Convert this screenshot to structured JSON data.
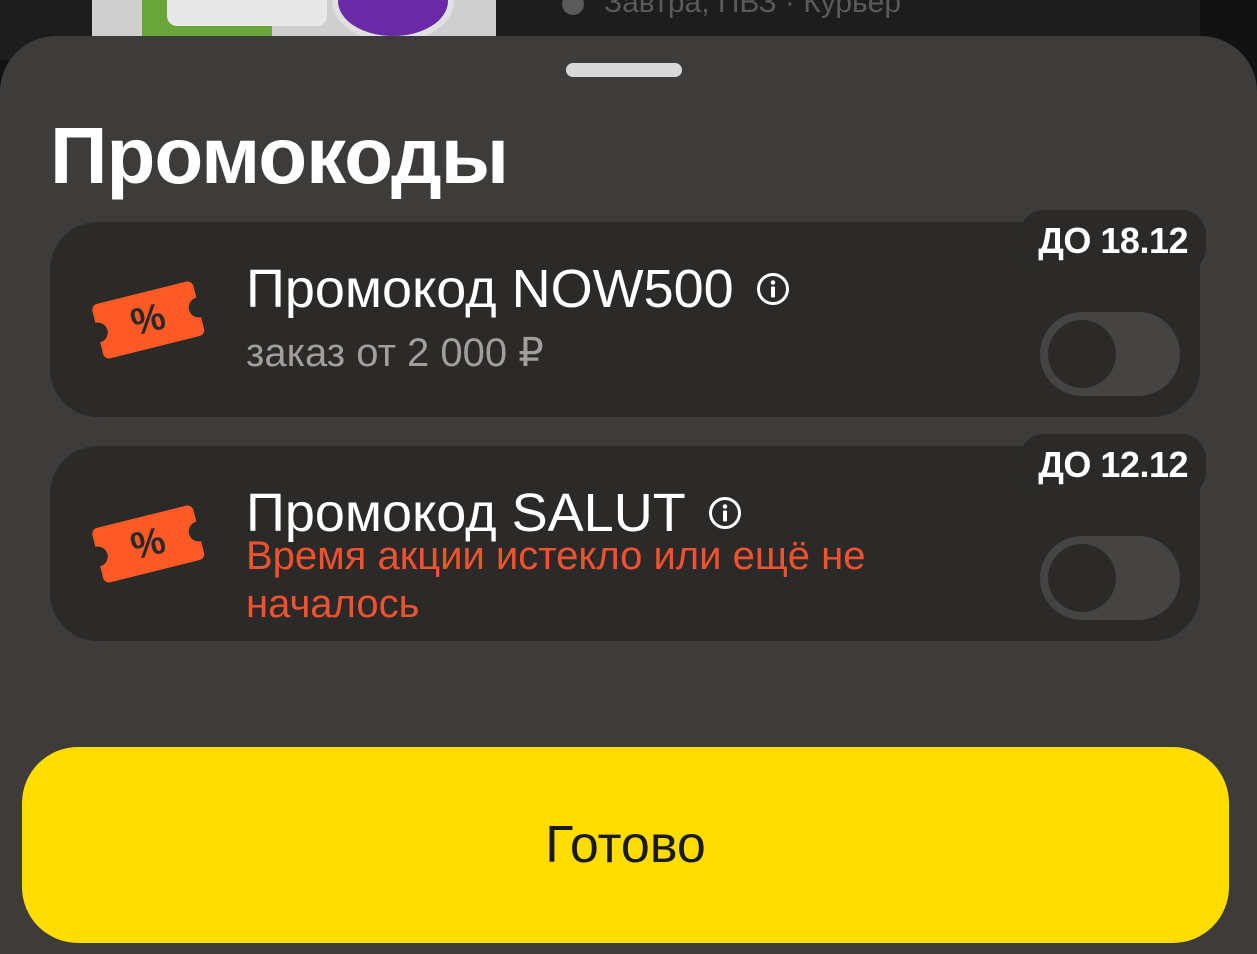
{
  "background": {
    "delivery_hint": "Завтра, ПВЗ · Курьер"
  },
  "sheet": {
    "title": "Промокоды"
  },
  "promos": [
    {
      "title": "Промокод NOW500",
      "subtitle": "заказ от 2 000 ₽",
      "badge": "ДО 18.12",
      "enabled": false,
      "icon": "discount-ticket-icon"
    },
    {
      "title": "Промокод SALUT",
      "error": "Время акции истекло или ещё не началось",
      "badge": "ДО 12.12",
      "enabled": false,
      "icon": "discount-ticket-icon"
    }
  ],
  "actions": {
    "done_label": "Готово"
  },
  "colors": {
    "accent": "#ffdd00",
    "ticket": "#ff5a26",
    "error": "#f0522f",
    "sheet": "#3d3c3b",
    "card": "#2b2a29"
  }
}
